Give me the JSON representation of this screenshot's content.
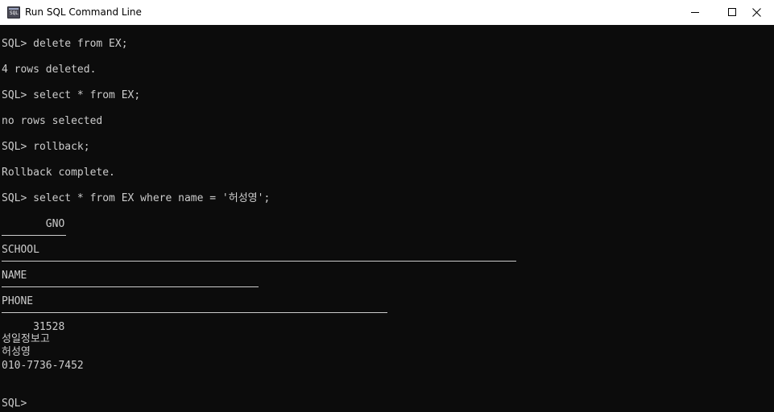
{
  "window": {
    "title": "Run SQL Command Line",
    "icon": "sqlplus-icon"
  },
  "controls": {
    "minimize_icon": "minimize-icon",
    "maximize_icon": "maximize-icon",
    "close_icon": "close-icon"
  },
  "console": {
    "lines": [
      "SQL> delete from EX;",
      "4 rows deleted.",
      "SQL> select * from EX;",
      "no rows selected",
      "SQL> rollback;",
      "Rollback complete.",
      "SQL> select * from EX where name = '허성영';",
      "       GNO",
      "SCHOOL",
      "NAME",
      "PHONE",
      "     31528",
      "성일정보고",
      "허성영",
      "010-7736-7452",
      "SQL>"
    ]
  },
  "colors": {
    "console_background": "#0c0c0c",
    "console_text": "#cccccc",
    "titlebar_background": "#ffffff"
  }
}
